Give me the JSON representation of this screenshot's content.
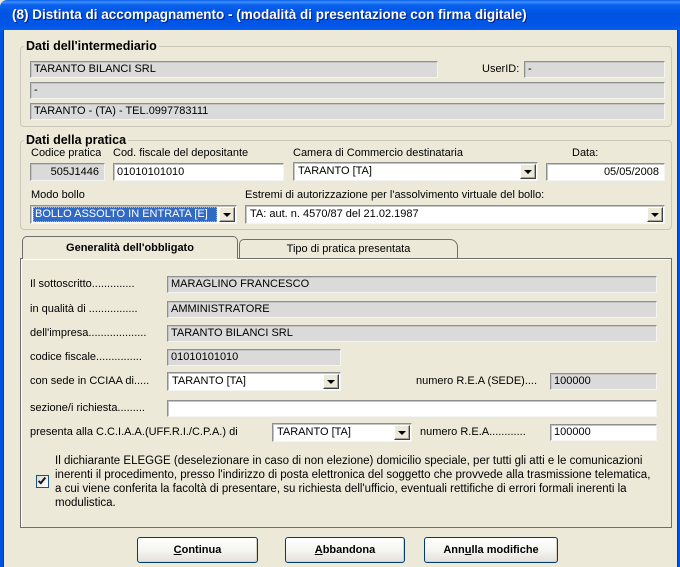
{
  "window": {
    "title": "(8) Distinta di accompagnamento - (modalità di presentazione con firma digitale)"
  },
  "colors": {
    "title_bar": "#0054E3",
    "window_bg": "#ECE9D8",
    "selection": "#316AC5",
    "readonly_field": "#DADADA"
  },
  "intermediario": {
    "legend": "Dati dell'intermediario",
    "denominazione": "TARANTO BILANCI SRL",
    "userid_label": "UserID:",
    "userid": "-",
    "riga2": "-",
    "riga3": "TARANTO - (TA) - TEL.0997783111"
  },
  "pratica": {
    "legend": "Dati della pratica",
    "codice_pratica": {
      "label": "Codice pratica",
      "value": "505J1446"
    },
    "cf_depositante": {
      "label": "Cod. fiscale del depositante",
      "value": "01010101010"
    },
    "camera": {
      "label": "Camera di Commercio destinataria",
      "value": "TARANTO [TA]"
    },
    "data": {
      "label": "Data:",
      "value": "05/05/2008"
    },
    "modo_bollo": {
      "label": "Modo bollo",
      "value": "BOLLO ASSOLTO IN ENTRATA [E]"
    },
    "estremi": {
      "label": "Estremi di autorizzazione per l'assolvimento virtuale del bollo:",
      "value": "TA: aut. n. 4570/87 del 21.02.1987"
    }
  },
  "tabs": [
    {
      "label": "Generalità dell'obbligato",
      "active": true
    },
    {
      "label": "Tipo di pratica presentata",
      "active": false
    }
  ],
  "obbligato": {
    "sottoscritto": {
      "label": "Il sottoscritto..............",
      "value": "MARAGLINO FRANCESCO"
    },
    "qualita": {
      "label": "in qualità di ................",
      "value": "AMMINISTRATORE"
    },
    "impresa": {
      "label": "dell'impresa...................",
      "value": "TARANTO BILANCI SRL"
    },
    "codice_fiscale": {
      "label": "codice fiscale...............",
      "value": "01010101010"
    },
    "sede_cciaa": {
      "label": "con sede in CCIAA di.....",
      "value": "TARANTO [TA]"
    },
    "rea_sede": {
      "label": "numero R.E.A (SEDE)....",
      "value": "100000"
    },
    "sezioni": {
      "label": "sezione/i richiesta.........",
      "value": ""
    },
    "presenta_cciaa": {
      "label": "presenta alla C.C.I.A.A.(UFF.R.I./C.P.A.) di",
      "value": "TARANTO [TA]"
    },
    "rea": {
      "label": "numero R.E.A............",
      "value": "100000"
    },
    "elezione_domicilio": {
      "checked": true,
      "text_lines": [
        "Il dichiarante ELEGGE (deselezionare in caso di non elezione) domicilio speciale, per tutti gli atti e le comunicazioni",
        "inerenti il procedimento, presso l'indirizzo di posta elettronica del soggetto che provvede alla trasmissione telematica,",
        "a cui viene conferita la facoltà di presentare, su richiesta dell'ufficio, eventuali rettifiche di errori formali inerenti la",
        "modulistica."
      ]
    }
  },
  "buttons": {
    "continua": {
      "label": "Continua",
      "access_key": "C"
    },
    "abbandona": {
      "label": "Abbandona",
      "access_key": "A"
    },
    "annulla": {
      "label": "Annulla modifiche",
      "access_key": "u"
    }
  }
}
